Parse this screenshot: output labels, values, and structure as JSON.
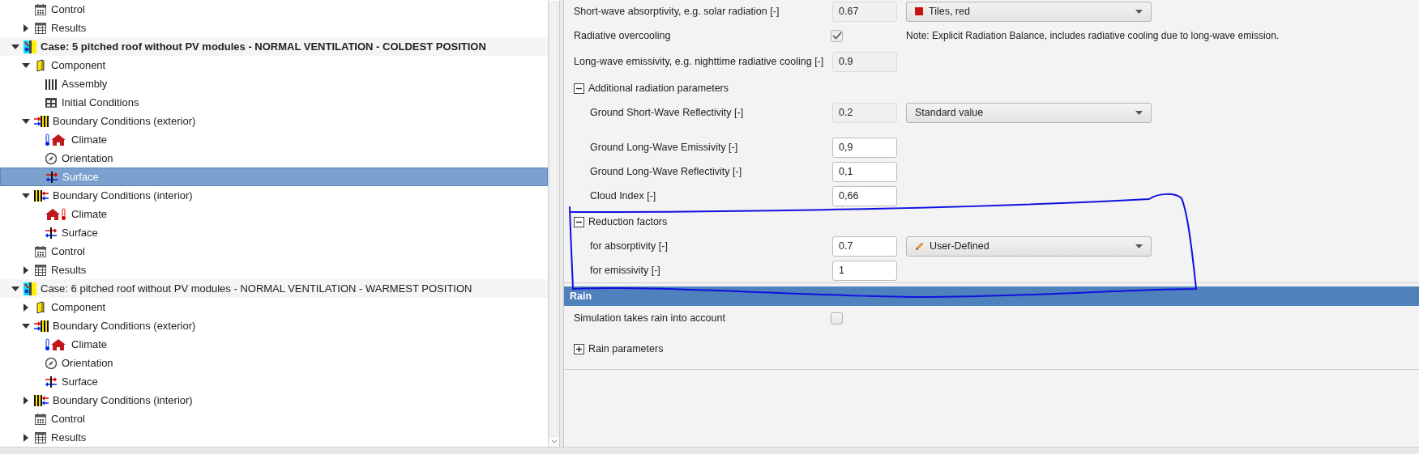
{
  "tree": {
    "continued_items": [
      {
        "kind": "control",
        "label": "Control",
        "selected": false
      },
      {
        "kind": "results",
        "label": "Results",
        "expanded": false,
        "selected": false
      }
    ],
    "cases": [
      {
        "kind": "case",
        "label": "Case: 5 pitched roof without PV modules - NORMAL VENTILATION - COLDEST POSITION",
        "active": true,
        "expanded": true,
        "selected": false,
        "children": [
          {
            "kind": "component",
            "label": "Component",
            "expanded": true,
            "selected": false,
            "children": [
              {
                "kind": "assembly",
                "label": "Assembly",
                "selected": false
              },
              {
                "kind": "initial-conditions",
                "label": "Initial Conditions",
                "selected": false
              }
            ]
          },
          {
            "kind": "boundary-exterior",
            "label": "Boundary Conditions (exterior)",
            "expanded": true,
            "selected": false,
            "children": [
              {
                "kind": "climate-exterior",
                "label": "Climate",
                "selected": false
              },
              {
                "kind": "orientation",
                "label": "Orientation",
                "selected": false
              },
              {
                "kind": "surface",
                "label": "Surface",
                "selected": true
              }
            ]
          },
          {
            "kind": "boundary-interior",
            "label": "Boundary Conditions (interior)",
            "expanded": true,
            "selected": false,
            "children": [
              {
                "kind": "climate-interior",
                "label": "Climate",
                "selected": false
              },
              {
                "kind": "surface",
                "label": "Surface",
                "selected": false
              }
            ]
          },
          {
            "kind": "control",
            "label": "Control",
            "selected": false
          },
          {
            "kind": "results",
            "label": "Results",
            "expanded": false,
            "selected": false
          }
        ]
      },
      {
        "kind": "case",
        "label": "Case: 6 pitched roof without PV modules - NORMAL VENTILATION - WARMEST POSITION",
        "active": false,
        "expanded": true,
        "selected": false,
        "children": [
          {
            "kind": "component",
            "label": "Component",
            "expanded": false,
            "selected": false
          },
          {
            "kind": "boundary-exterior",
            "label": "Boundary Conditions (exterior)",
            "expanded": true,
            "selected": false,
            "children": [
              {
                "kind": "climate-exterior",
                "label": "Climate",
                "selected": false
              },
              {
                "kind": "orientation",
                "label": "Orientation",
                "selected": false
              },
              {
                "kind": "surface",
                "label": "Surface",
                "selected": false
              }
            ]
          },
          {
            "kind": "boundary-interior",
            "label": "Boundary Conditions (interior)",
            "expanded": false,
            "selected": false
          },
          {
            "kind": "control",
            "label": "Control",
            "selected": false
          },
          {
            "kind": "results",
            "label": "Results",
            "expanded": false,
            "selected": false
          }
        ]
      }
    ]
  },
  "radiation": {
    "items": [
      {
        "kind": "field",
        "label": "Short-wave absorptivity, e.g. solar radiation [-]",
        "value": "0.67",
        "editable": false,
        "dropdown": {
          "kind": "swatch",
          "value": "Tiles, red"
        }
      },
      {
        "kind": "checkbox",
        "label": "Radiative overcooling",
        "checked": true,
        "note": "Note: Explicit Radiation Balance, includes radiative cooling due to long-wave emission."
      },
      {
        "kind": "field",
        "label": "Long-wave emissivity, e.g. nighttime radiative cooling [-]",
        "value": "0.9",
        "editable": false
      },
      {
        "kind": "group",
        "label": "Additional radiation parameters",
        "expanded": true,
        "children": [
          {
            "kind": "field",
            "label": "Ground Short-Wave Reflectivity [-]",
            "value": "0.2",
            "editable": false,
            "dropdown": {
              "kind": "plain",
              "value": "Standard value"
            }
          },
          {
            "kind": "field",
            "label": "Ground Long-Wave Emissivity [-]",
            "value": "0,9",
            "editable": true
          },
          {
            "kind": "field",
            "label": "Ground Long-Wave Reflectivity [-]",
            "value": "0,1",
            "editable": true
          },
          {
            "kind": "field",
            "label": "Cloud Index [-]",
            "value": "0,66",
            "editable": true
          }
        ]
      },
      {
        "kind": "group",
        "label": "Reduction factors",
        "expanded": true,
        "children": [
          {
            "kind": "field",
            "label": "for absorptivity [-]",
            "value": "0.7",
            "editable": true,
            "dropdown": {
              "kind": "user-defined",
              "value": "User-Defined"
            }
          },
          {
            "kind": "field",
            "label": "for emissivity [-]",
            "value": "1",
            "editable": true
          }
        ]
      }
    ]
  },
  "rain": {
    "title": "Rain",
    "items": [
      {
        "kind": "checkbox",
        "label": "Simulation takes rain into account",
        "checked": false
      },
      {
        "kind": "group",
        "label": "Rain parameters",
        "expanded": false
      }
    ]
  }
}
